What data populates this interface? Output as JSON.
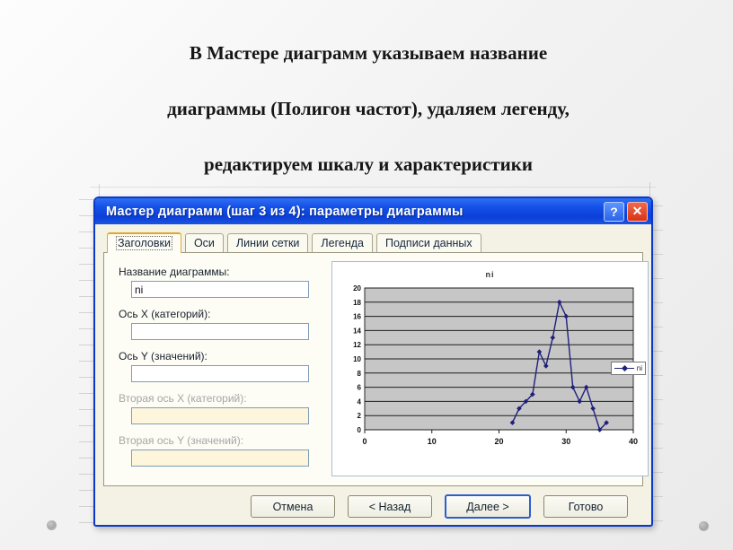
{
  "slide": {
    "heading_lines": [
      "В Мастере диаграмм указываем название",
      "диаграммы (Полигон частот), удаляем легенду,",
      "редактируем шкалу и характеристики"
    ]
  },
  "dialog": {
    "title": "Мастер диаграмм (шаг 3 из 4): параметры диаграммы",
    "help_button": "?",
    "close_button": "✕",
    "tabs": [
      {
        "label": "Заголовки",
        "active": true
      },
      {
        "label": "Оси",
        "active": false
      },
      {
        "label": "Линии сетки",
        "active": false
      },
      {
        "label": "Легенда",
        "active": false
      },
      {
        "label": "Подписи данных",
        "active": false
      }
    ],
    "fields": [
      {
        "label": "Название диаграммы:",
        "value": "ni",
        "placeholder": "",
        "disabled": false
      },
      {
        "label": "Ось X (категорий):",
        "value": "",
        "placeholder": "",
        "disabled": false
      },
      {
        "label": "Ось Y (значений):",
        "value": "",
        "placeholder": "",
        "disabled": false
      },
      {
        "label": "Вторая ось X (категорий):",
        "value": "",
        "placeholder": "",
        "disabled": true
      },
      {
        "label": "Вторая ось Y (значений):",
        "value": "",
        "placeholder": "",
        "disabled": true
      }
    ],
    "buttons": [
      {
        "label": "Отмена",
        "default": false
      },
      {
        "label": "< Назад",
        "default": false
      },
      {
        "label": "Далее >",
        "default": true
      },
      {
        "label": "Готово",
        "default": false
      }
    ]
  },
  "chart_data": {
    "type": "line",
    "title": "ni",
    "xlabel": "",
    "ylabel": "",
    "xlim": [
      0,
      40
    ],
    "ylim": [
      0,
      20
    ],
    "xticks": [
      0,
      10,
      20,
      30,
      40
    ],
    "yticks": [
      0,
      2,
      4,
      6,
      8,
      10,
      12,
      14,
      16,
      18,
      20
    ],
    "grid": "horizontal",
    "legend": {
      "position": "right",
      "entries": [
        "ni"
      ]
    },
    "plot_area_color": "#c6c6c6",
    "series": [
      {
        "name": "ni",
        "color": "#20207a",
        "marker": "diamond",
        "x": [
          22,
          23,
          24,
          25,
          26,
          27,
          28,
          29,
          30,
          31,
          32,
          33,
          34,
          35,
          36
        ],
        "y": [
          1,
          3,
          4,
          5,
          11,
          9,
          13,
          18,
          16,
          6,
          4,
          6,
          3,
          0,
          1
        ]
      }
    ]
  },
  "decorations": {
    "dot_left": "decorative-dot",
    "dot_right": "decorative-dot"
  }
}
